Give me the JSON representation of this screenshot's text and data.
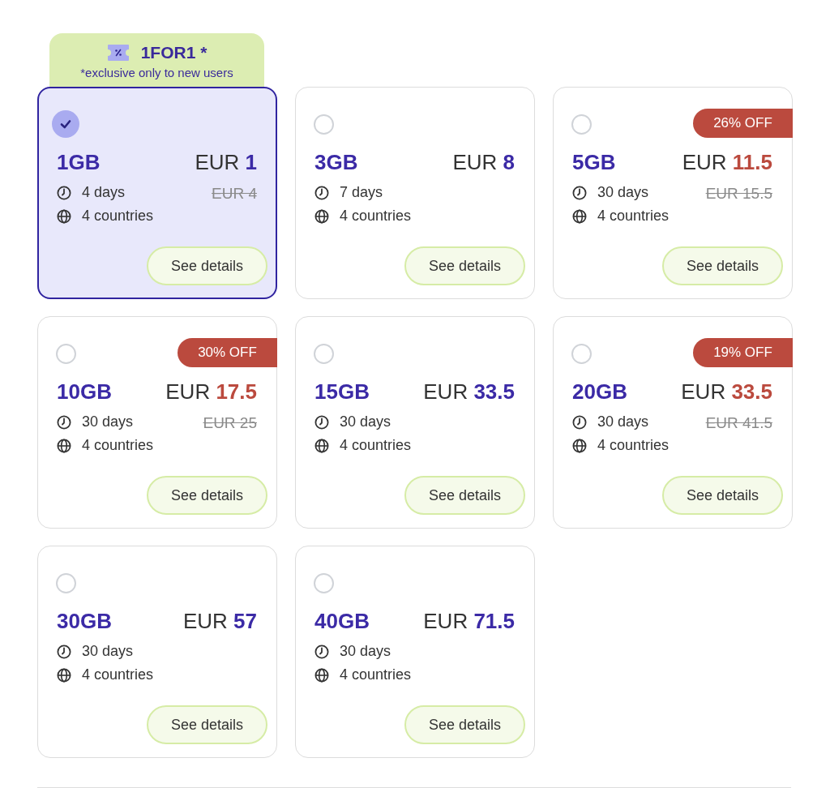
{
  "promo": {
    "code": "1FOR1 *",
    "note": "*exclusive only to new users"
  },
  "plans": [
    {
      "selected": true,
      "data": "1GB",
      "price": "EUR **1**",
      "sale": false,
      "duration": "4 days",
      "old_price": "EUR 4",
      "coverage": "4 countries",
      "button": "See details"
    },
    {
      "selected": false,
      "data": "3GB",
      "price": "EUR **8**",
      "sale": false,
      "duration": "7 days",
      "coverage": "4 countries",
      "button": "See details"
    },
    {
      "selected": false,
      "badge": "26% OFF",
      "data": "5GB",
      "price": "EUR **11.5**",
      "sale": true,
      "duration": "30 days",
      "old_price": "EUR 15.5",
      "coverage": "4 countries",
      "button": "See details"
    },
    {
      "selected": false,
      "badge": "30% OFF",
      "data": "10GB",
      "price": "EUR **17.5**",
      "sale": true,
      "duration": "30 days",
      "old_price": "EUR 25",
      "coverage": "4 countries",
      "button": "See details"
    },
    {
      "selected": false,
      "data": "15GB",
      "price": "EUR **33.5**",
      "sale": false,
      "duration": "30 days",
      "coverage": "4 countries",
      "button": "See details"
    },
    {
      "selected": false,
      "badge": "19% OFF",
      "data": "20GB",
      "price": "EUR **33.5**",
      "sale": true,
      "duration": "30 days",
      "old_price": "EUR 41.5",
      "coverage": "4 countries",
      "button": "See details"
    },
    {
      "selected": false,
      "data": "30GB",
      "price": "EUR **57**",
      "sale": false,
      "duration": "30 days",
      "coverage": "4 countries",
      "button": "See details"
    },
    {
      "selected": false,
      "data": "40GB",
      "price": "EUR **71.5**",
      "sale": false,
      "duration": "30 days",
      "coverage": "4 countries",
      "button": "See details"
    }
  ]
}
